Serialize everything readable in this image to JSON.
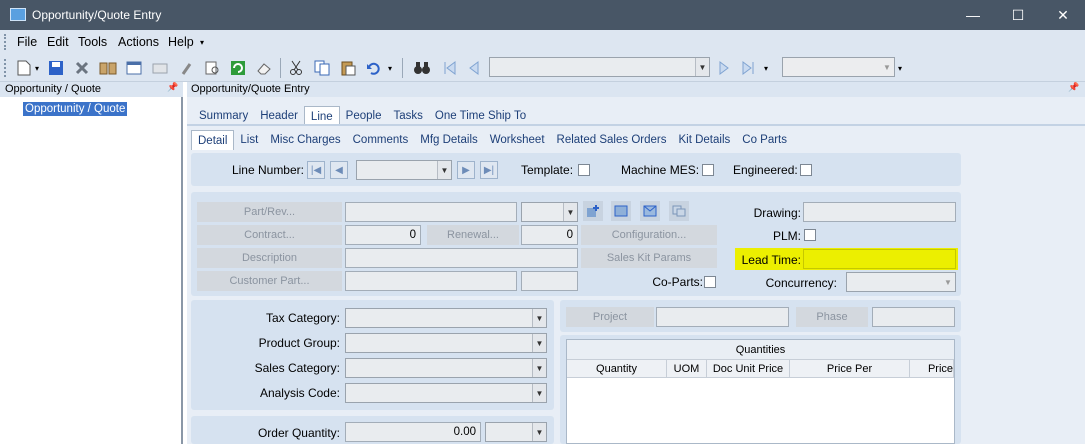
{
  "window": {
    "title": "Opportunity/Quote Entry",
    "min": "—",
    "max": "☐",
    "close": "✕"
  },
  "menu": [
    "File",
    "Edit",
    "Tools",
    "Actions",
    "Help"
  ],
  "left_panel": {
    "title": "Opportunity / Quote",
    "tree_item": "Opportunity / Quote",
    "pin": "📌"
  },
  "right_panel": {
    "title": "Opportunity/Quote Entry",
    "pin": "📌"
  },
  "main_tabs": [
    "Summary",
    "Header",
    "Line",
    "People",
    "Tasks",
    "One Time Ship To"
  ],
  "main_active": "Line",
  "sub_tabs": [
    "Detail",
    "List",
    "Misc Charges",
    "Comments",
    "Mfg Details",
    "Worksheet",
    "Related Sales Orders",
    "Kit Details",
    "Co Parts"
  ],
  "sub_active": "Detail",
  "line_row": {
    "line_number_label": "Line Number:",
    "template_label": "Template:",
    "machine_mes_label": "Machine MES:",
    "engineered_label": "Engineered:"
  },
  "part_section": {
    "part_rev": "Part/Rev...",
    "contract": "Contract...",
    "contract_value": "0",
    "renewal": "Renewal...",
    "renewal_value": "0",
    "configuration": "Configuration...",
    "description": "Description",
    "sales_kit_params": "Sales Kit Params",
    "customer_part": "Customer Part...",
    "co_parts_label": "Co-Parts:",
    "drawing_label": "Drawing:",
    "plm_label": "PLM:",
    "lead_time_label": "Lead Time:",
    "concurrency_label": "Concurrency:"
  },
  "category_section": {
    "tax_category": "Tax Category:",
    "product_group": "Product Group:",
    "sales_category": "Sales Category:",
    "analysis_code": "Analysis Code:"
  },
  "project_section": {
    "project": "Project",
    "phase": "Phase"
  },
  "quantities": {
    "title": "Quantities",
    "columns": [
      "Quantity",
      "UOM",
      "Doc Unit Price",
      "Price Per",
      "Price"
    ]
  },
  "order_quantity": {
    "label": "Order Quantity:",
    "value": "0.00"
  },
  "colors": {
    "titlebar": "#485666",
    "highlight": "#ecef00",
    "accent": "#3b73c9"
  }
}
